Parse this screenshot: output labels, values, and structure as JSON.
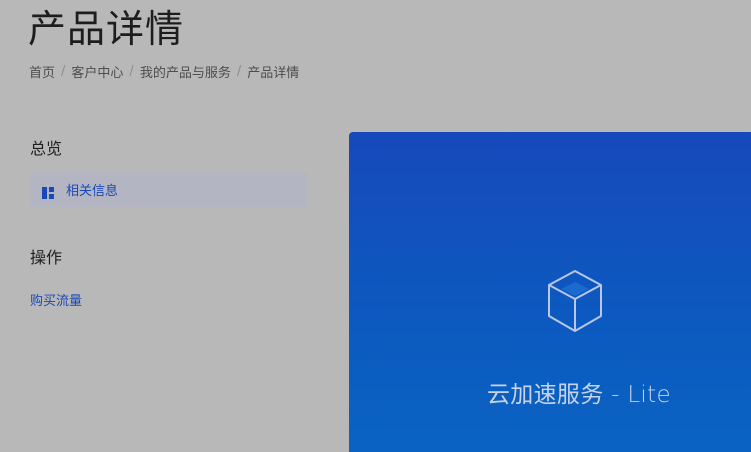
{
  "header": {
    "title": "产品详情"
  },
  "breadcrumb": {
    "items": [
      "首页",
      "客户中心",
      "我的产品与服务",
      "产品详情"
    ],
    "separator": "/"
  },
  "sidebar": {
    "overview_heading": "总览",
    "overview_items": [
      {
        "label": "相关信息",
        "icon": "dashboard-icon",
        "active": true
      }
    ],
    "actions_heading": "操作",
    "action_links": [
      {
        "label": "购买流量"
      }
    ]
  },
  "hero": {
    "title": "云加速服务 - Lite",
    "icon": "cube-icon"
  },
  "colors": {
    "background": "#b8b8b8",
    "link": "#1a48b8",
    "active_item_bg": "#b3b5c2",
    "hero_gradient_top": "#1749bb",
    "hero_gradient_bottom": "#0a63c2"
  }
}
